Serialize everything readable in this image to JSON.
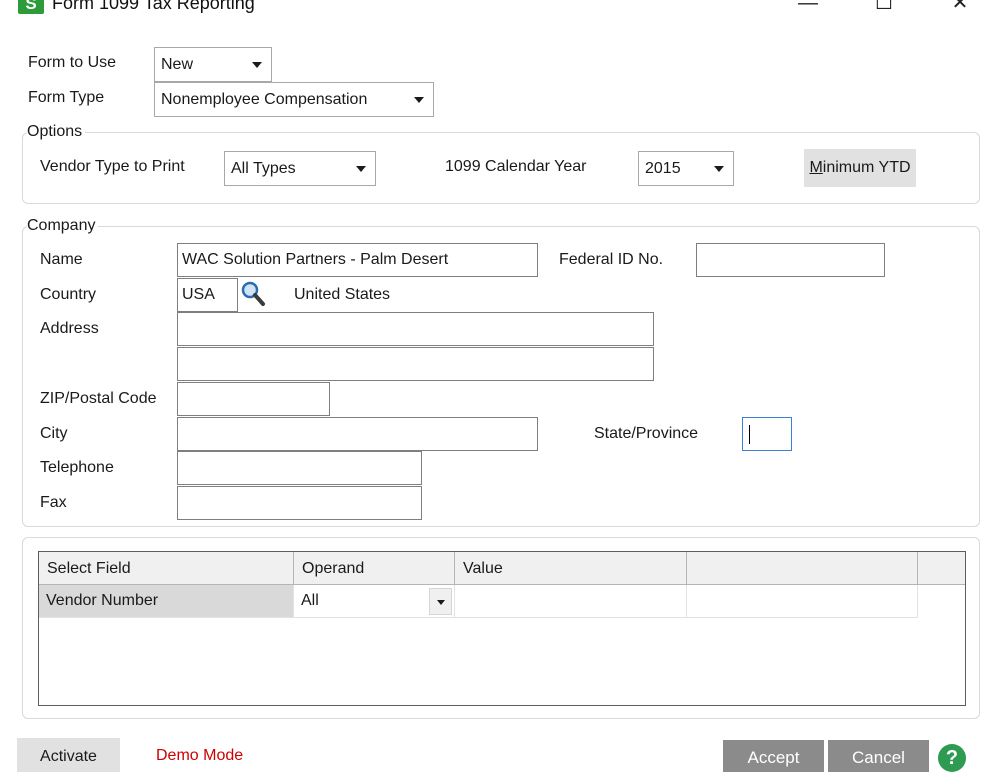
{
  "window": {
    "app_icon_letter": "S",
    "title": "Form 1099 Tax Reporting",
    "minimize_glyph": "—",
    "maximize_glyph": "☐",
    "close_glyph": "✕"
  },
  "form_to_use": {
    "label": "Form to Use",
    "value": "New"
  },
  "form_type": {
    "label": "Form Type",
    "value": "Nonemployee Compensation"
  },
  "options": {
    "group_label": "Options",
    "vendor_type_label": "Vendor Type to Print",
    "vendor_type_value": "All Types",
    "calendar_year_label": "1099 Calendar Year",
    "calendar_year_value": "2015",
    "minimum_ytd_mnemonic": "M",
    "minimum_ytd_rest": "inimum YTD"
  },
  "company": {
    "group_label": "Company",
    "name_label": "Name",
    "name_value": "WAC Solution Partners - Palm Desert",
    "federal_id_label": "Federal ID No.",
    "federal_id_value": "",
    "country_label": "Country",
    "country_code": "USA",
    "country_name": "United States",
    "address_label": "Address",
    "address_line1": "",
    "address_line2": "",
    "zip_label": "ZIP/Postal Code",
    "zip_value": "",
    "city_label": "City",
    "city_value": "",
    "state_label": "State/Province",
    "state_value": "",
    "telephone_label": "Telephone",
    "telephone_value": "",
    "fax_label": "Fax",
    "fax_value": ""
  },
  "selection_grid": {
    "columns": [
      "Select Field",
      "Operand",
      "Value",
      ""
    ],
    "rows": [
      {
        "select_field": "Vendor Number",
        "operand": "All",
        "value": "",
        "extra": ""
      }
    ]
  },
  "footer": {
    "activate_label": "Activate",
    "demo_mode_text": "Demo Mode",
    "accept_label": "Accept",
    "cancel_label": "Cancel",
    "help_glyph": "?"
  },
  "colors": {
    "app_icon_green": "#2e9b3a",
    "demo_mode_red": "#d10000",
    "focus_blue": "#3c7fd6",
    "help_green": "#2f9b52"
  }
}
